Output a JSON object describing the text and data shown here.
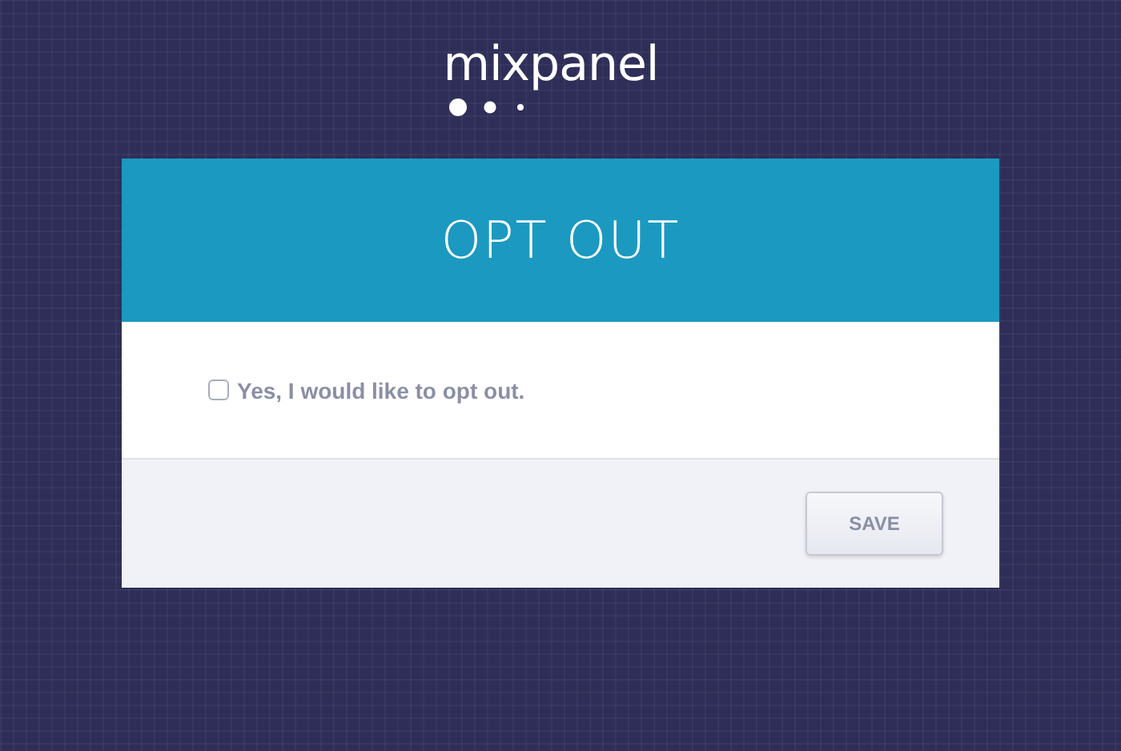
{
  "logo": {
    "text": "mixpanel"
  },
  "card": {
    "title": "OPT OUT",
    "option": {
      "label": "Yes, I would like to opt out.",
      "checked": false
    },
    "buttons": [
      {
        "label": "SAVE"
      }
    ]
  }
}
